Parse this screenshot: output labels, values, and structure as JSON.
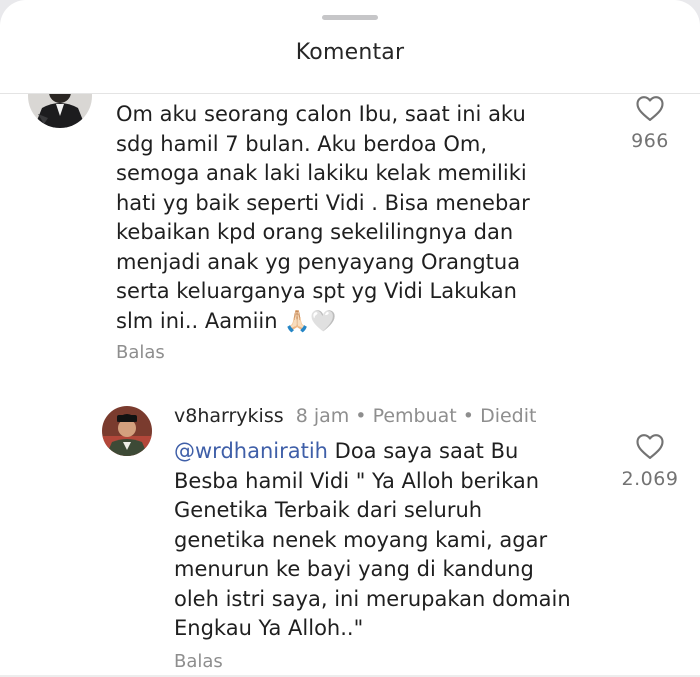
{
  "header": {
    "title": "Komentar"
  },
  "comments": [
    {
      "text": "Om aku seorang calon Ibu, saat ini aku\nsdg hamil 7 bulan. Aku berdoa Om,\nsemoga anak laki lakiku kelak memiliki\nhati yg baik seperti Vidi . Bisa menebar\nkebaikan kpd orang sekelilingnya dan\nmenjadi anak yg penyayang Orangtua\nserta keluarganya spt yg Vidi Lakukan\nslm ini.. Aamiin 🙏🏻🤍",
      "likes": "966",
      "reply_label": "Balas"
    },
    {
      "username": "v8harrykiss",
      "time": "8 jam",
      "sep1": "•",
      "badge": "Pembuat",
      "sep2": "•",
      "edited": "Diedit",
      "mention": "@wrdhaniratih",
      "text_first": " Doa saya saat Bu",
      "text": "Besba hamil Vidi \" Ya Alloh berikan\nGenetika Terbaik dari seluruh\ngenetika nenek moyang kami, agar\nmenurun ke bayi yang di kandung\noleh istri saya, ini merupakan domain\nEngkau Ya Alloh..\"",
      "likes": "2.069",
      "reply_label": "Balas"
    }
  ]
}
